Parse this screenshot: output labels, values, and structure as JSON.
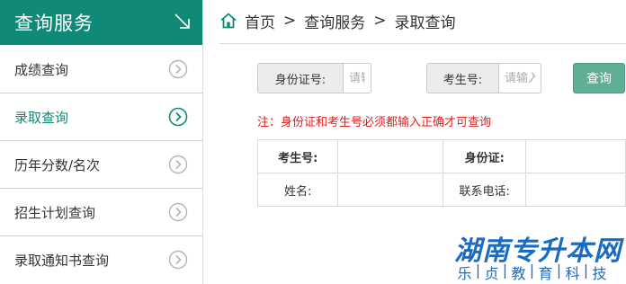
{
  "sidebar": {
    "title": "查询服务",
    "items": [
      {
        "label": "成绩查询",
        "active": false
      },
      {
        "label": "录取查询",
        "active": true
      },
      {
        "label": "历年分数/名次",
        "active": false
      },
      {
        "label": "招生计划查询",
        "active": false
      },
      {
        "label": "录取通知书查询",
        "active": false
      }
    ]
  },
  "breadcrumb": {
    "items": [
      "首页",
      "查询服务",
      "录取查询"
    ],
    "separator": ">"
  },
  "form": {
    "id_label": "身份证号:",
    "id_placeholder": "请输入身份证号",
    "exam_label": "考生号:",
    "exam_placeholder": "请输入考生号",
    "query_button": "查询"
  },
  "notice": "注：身份证和考生号必须都输入正确才可查询",
  "result_table": {
    "row1": {
      "label1": "考生号:",
      "value1": "",
      "label2": "身份证:",
      "value2": ""
    },
    "row2": {
      "label1": "姓名:",
      "value1": "",
      "label2": "联系电话:",
      "value2": ""
    }
  },
  "watermark": {
    "main": "湖南专升本网",
    "sub": [
      "乐",
      "贞",
      "教",
      "育",
      "科",
      "技"
    ]
  },
  "colors": {
    "accent": "#0f8a76",
    "button": "#5fae96",
    "notice": "#e02020",
    "watermark": "#1a6cc2"
  }
}
